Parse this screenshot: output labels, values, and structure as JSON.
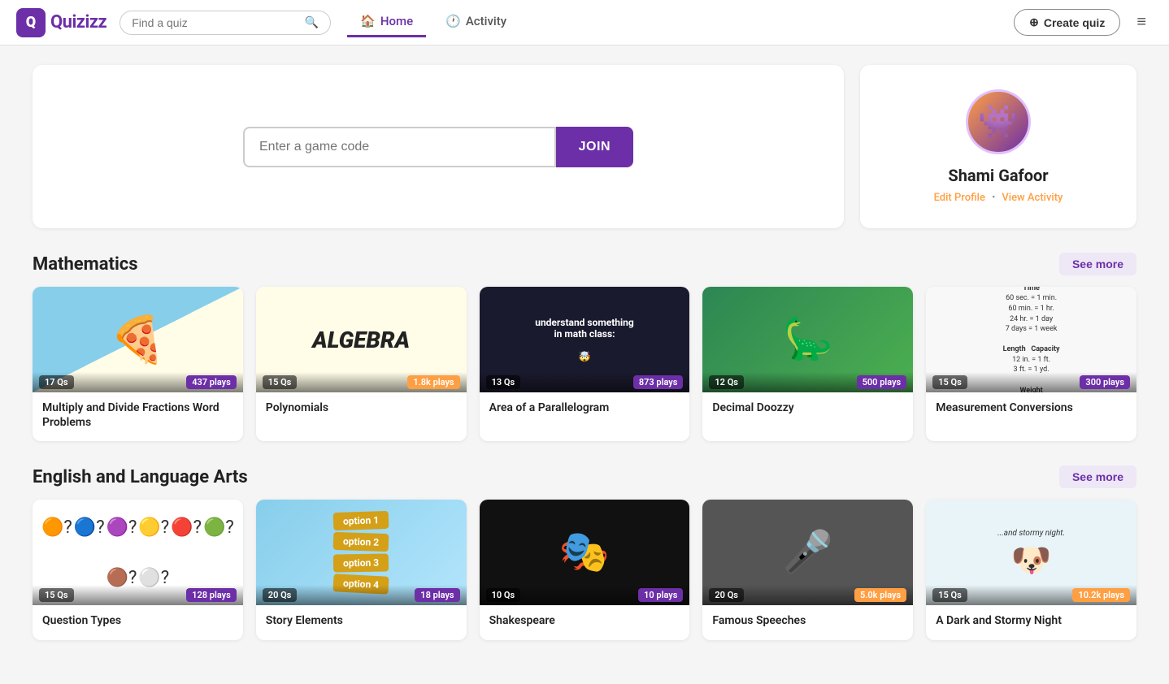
{
  "navbar": {
    "logo_text": "Quizizz",
    "search_placeholder": "Find a quiz",
    "nav_links": [
      {
        "id": "home",
        "label": "Home",
        "icon": "🏠",
        "active": true
      },
      {
        "id": "activity",
        "label": "Activity",
        "icon": "🕐",
        "active": false
      }
    ],
    "create_quiz_label": "Create quiz",
    "menu_icon": "≡"
  },
  "hero": {
    "game_code_placeholder": "Enter a game code",
    "join_label": "JOIN"
  },
  "profile": {
    "name": "Shami Gafoor",
    "edit_profile_label": "Edit Profile",
    "view_activity_label": "View Activity",
    "dot": "•",
    "avatar_emoji": "👾"
  },
  "math_section": {
    "title": "Mathematics",
    "see_more_label": "See more",
    "quizzes": [
      {
        "title": "Multiply and Divide Fractions Word Problems",
        "qs": "17 Qs",
        "plays": "437 plays",
        "plays_highlight": false,
        "thumb_type": "fractions"
      },
      {
        "title": "Polynomials",
        "qs": "15 Qs",
        "plays": "1.8k plays",
        "plays_highlight": true,
        "thumb_type": "algebra"
      },
      {
        "title": "Area of a Parallelogram",
        "qs": "13 Qs",
        "plays": "873 plays",
        "plays_highlight": false,
        "thumb_type": "math_meme"
      },
      {
        "title": "Decimal Doozzy",
        "qs": "12 Qs",
        "plays": "500 plays",
        "plays_highlight": false,
        "thumb_type": "decimal"
      },
      {
        "title": "Measurement Conversions",
        "qs": "15 Qs",
        "plays": "300 plays",
        "plays_highlight": false,
        "thumb_type": "measurement"
      }
    ]
  },
  "ela_section": {
    "title": "English and Language Arts",
    "see_more_label": "See more",
    "quizzes": [
      {
        "title": "Question Types",
        "qs": "15 Qs",
        "plays": "128 plays",
        "plays_highlight": false,
        "thumb_type": "qmarks"
      },
      {
        "title": "Story Elements",
        "qs": "20 Qs",
        "plays": "18 plays",
        "plays_highlight": false,
        "thumb_type": "signs"
      },
      {
        "title": "Shakespeare",
        "qs": "10 Qs",
        "plays": "10 plays",
        "plays_highlight": false,
        "thumb_type": "shakespeare"
      },
      {
        "title": "Famous Speeches",
        "qs": "20 Qs",
        "plays": "5.0k plays",
        "plays_highlight": true,
        "thumb_type": "mlk"
      },
      {
        "title": "A Dark and Stormy Night",
        "qs": "15 Qs",
        "plays": "10.2k plays",
        "plays_highlight": true,
        "thumb_type": "snoopy"
      }
    ]
  }
}
